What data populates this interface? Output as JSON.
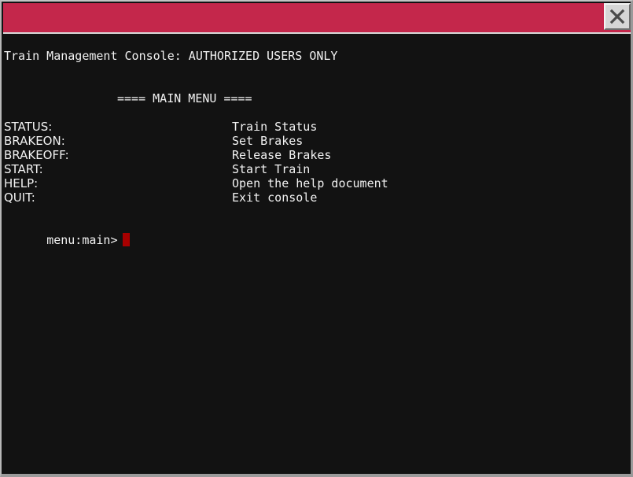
{
  "window": {
    "close_label": "close",
    "colors": {
      "titlebar": "#c4274b",
      "background": "#121212",
      "text": "#f2f2f2",
      "cursor": "#a80000"
    }
  },
  "console": {
    "banner": "Train Management Console: AUTHORIZED USERS ONLY",
    "menu_title": "==== MAIN MENU ====",
    "menu_items": [
      {
        "command": "STATUS:",
        "description": "Train Status"
      },
      {
        "command": "BRAKEON:",
        "description": "Set Brakes"
      },
      {
        "command": "BRAKEOFF:",
        "description": "Release Brakes"
      },
      {
        "command": "START:",
        "description": "Start Train"
      },
      {
        "command": "HELP:",
        "description": "Open the help document"
      },
      {
        "command": "QUIT:",
        "description": "Exit console"
      }
    ],
    "prompt": "menu:main>",
    "input_value": ""
  }
}
